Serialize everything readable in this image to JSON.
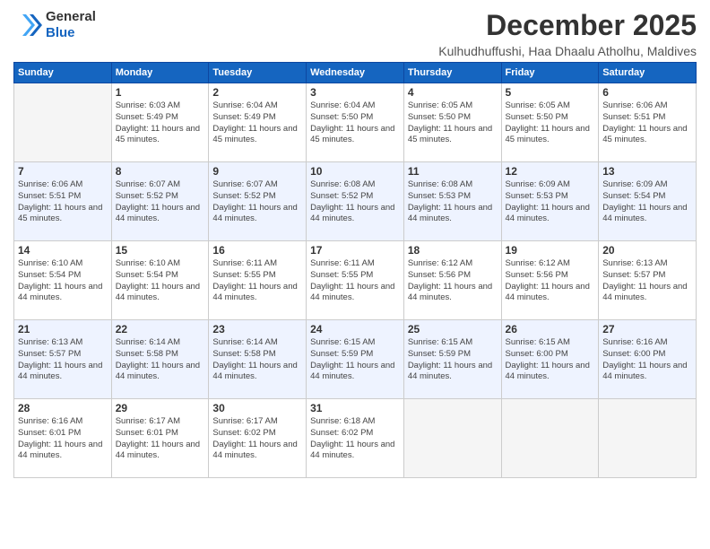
{
  "header": {
    "logo_general": "General",
    "logo_blue": "Blue",
    "title": "December 2025",
    "subtitle": "Kulhudhuffushi, Haa Dhaalu Atholhu, Maldives"
  },
  "weekdays": [
    "Sunday",
    "Monday",
    "Tuesday",
    "Wednesday",
    "Thursday",
    "Friday",
    "Saturday"
  ],
  "weeks": [
    [
      {
        "day": "",
        "sunrise": "",
        "sunset": "",
        "daylight": ""
      },
      {
        "day": "1",
        "sunrise": "Sunrise: 6:03 AM",
        "sunset": "Sunset: 5:49 PM",
        "daylight": "Daylight: 11 hours and 45 minutes."
      },
      {
        "day": "2",
        "sunrise": "Sunrise: 6:04 AM",
        "sunset": "Sunset: 5:49 PM",
        "daylight": "Daylight: 11 hours and 45 minutes."
      },
      {
        "day": "3",
        "sunrise": "Sunrise: 6:04 AM",
        "sunset": "Sunset: 5:50 PM",
        "daylight": "Daylight: 11 hours and 45 minutes."
      },
      {
        "day": "4",
        "sunrise": "Sunrise: 6:05 AM",
        "sunset": "Sunset: 5:50 PM",
        "daylight": "Daylight: 11 hours and 45 minutes."
      },
      {
        "day": "5",
        "sunrise": "Sunrise: 6:05 AM",
        "sunset": "Sunset: 5:50 PM",
        "daylight": "Daylight: 11 hours and 45 minutes."
      },
      {
        "day": "6",
        "sunrise": "Sunrise: 6:06 AM",
        "sunset": "Sunset: 5:51 PM",
        "daylight": "Daylight: 11 hours and 45 minutes."
      }
    ],
    [
      {
        "day": "7",
        "sunrise": "Sunrise: 6:06 AM",
        "sunset": "Sunset: 5:51 PM",
        "daylight": "Daylight: 11 hours and 45 minutes."
      },
      {
        "day": "8",
        "sunrise": "Sunrise: 6:07 AM",
        "sunset": "Sunset: 5:52 PM",
        "daylight": "Daylight: 11 hours and 44 minutes."
      },
      {
        "day": "9",
        "sunrise": "Sunrise: 6:07 AM",
        "sunset": "Sunset: 5:52 PM",
        "daylight": "Daylight: 11 hours and 44 minutes."
      },
      {
        "day": "10",
        "sunrise": "Sunrise: 6:08 AM",
        "sunset": "Sunset: 5:52 PM",
        "daylight": "Daylight: 11 hours and 44 minutes."
      },
      {
        "day": "11",
        "sunrise": "Sunrise: 6:08 AM",
        "sunset": "Sunset: 5:53 PM",
        "daylight": "Daylight: 11 hours and 44 minutes."
      },
      {
        "day": "12",
        "sunrise": "Sunrise: 6:09 AM",
        "sunset": "Sunset: 5:53 PM",
        "daylight": "Daylight: 11 hours and 44 minutes."
      },
      {
        "day": "13",
        "sunrise": "Sunrise: 6:09 AM",
        "sunset": "Sunset: 5:54 PM",
        "daylight": "Daylight: 11 hours and 44 minutes."
      }
    ],
    [
      {
        "day": "14",
        "sunrise": "Sunrise: 6:10 AM",
        "sunset": "Sunset: 5:54 PM",
        "daylight": "Daylight: 11 hours and 44 minutes."
      },
      {
        "day": "15",
        "sunrise": "Sunrise: 6:10 AM",
        "sunset": "Sunset: 5:54 PM",
        "daylight": "Daylight: 11 hours and 44 minutes."
      },
      {
        "day": "16",
        "sunrise": "Sunrise: 6:11 AM",
        "sunset": "Sunset: 5:55 PM",
        "daylight": "Daylight: 11 hours and 44 minutes."
      },
      {
        "day": "17",
        "sunrise": "Sunrise: 6:11 AM",
        "sunset": "Sunset: 5:55 PM",
        "daylight": "Daylight: 11 hours and 44 minutes."
      },
      {
        "day": "18",
        "sunrise": "Sunrise: 6:12 AM",
        "sunset": "Sunset: 5:56 PM",
        "daylight": "Daylight: 11 hours and 44 minutes."
      },
      {
        "day": "19",
        "sunrise": "Sunrise: 6:12 AM",
        "sunset": "Sunset: 5:56 PM",
        "daylight": "Daylight: 11 hours and 44 minutes."
      },
      {
        "day": "20",
        "sunrise": "Sunrise: 6:13 AM",
        "sunset": "Sunset: 5:57 PM",
        "daylight": "Daylight: 11 hours and 44 minutes."
      }
    ],
    [
      {
        "day": "21",
        "sunrise": "Sunrise: 6:13 AM",
        "sunset": "Sunset: 5:57 PM",
        "daylight": "Daylight: 11 hours and 44 minutes."
      },
      {
        "day": "22",
        "sunrise": "Sunrise: 6:14 AM",
        "sunset": "Sunset: 5:58 PM",
        "daylight": "Daylight: 11 hours and 44 minutes."
      },
      {
        "day": "23",
        "sunrise": "Sunrise: 6:14 AM",
        "sunset": "Sunset: 5:58 PM",
        "daylight": "Daylight: 11 hours and 44 minutes."
      },
      {
        "day": "24",
        "sunrise": "Sunrise: 6:15 AM",
        "sunset": "Sunset: 5:59 PM",
        "daylight": "Daylight: 11 hours and 44 minutes."
      },
      {
        "day": "25",
        "sunrise": "Sunrise: 6:15 AM",
        "sunset": "Sunset: 5:59 PM",
        "daylight": "Daylight: 11 hours and 44 minutes."
      },
      {
        "day": "26",
        "sunrise": "Sunrise: 6:15 AM",
        "sunset": "Sunset: 6:00 PM",
        "daylight": "Daylight: 11 hours and 44 minutes."
      },
      {
        "day": "27",
        "sunrise": "Sunrise: 6:16 AM",
        "sunset": "Sunset: 6:00 PM",
        "daylight": "Daylight: 11 hours and 44 minutes."
      }
    ],
    [
      {
        "day": "28",
        "sunrise": "Sunrise: 6:16 AM",
        "sunset": "Sunset: 6:01 PM",
        "daylight": "Daylight: 11 hours and 44 minutes."
      },
      {
        "day": "29",
        "sunrise": "Sunrise: 6:17 AM",
        "sunset": "Sunset: 6:01 PM",
        "daylight": "Daylight: 11 hours and 44 minutes."
      },
      {
        "day": "30",
        "sunrise": "Sunrise: 6:17 AM",
        "sunset": "Sunset: 6:02 PM",
        "daylight": "Daylight: 11 hours and 44 minutes."
      },
      {
        "day": "31",
        "sunrise": "Sunrise: 6:18 AM",
        "sunset": "Sunset: 6:02 PM",
        "daylight": "Daylight: 11 hours and 44 minutes."
      },
      {
        "day": "",
        "sunrise": "",
        "sunset": "",
        "daylight": ""
      },
      {
        "day": "",
        "sunrise": "",
        "sunset": "",
        "daylight": ""
      },
      {
        "day": "",
        "sunrise": "",
        "sunset": "",
        "daylight": ""
      }
    ]
  ]
}
